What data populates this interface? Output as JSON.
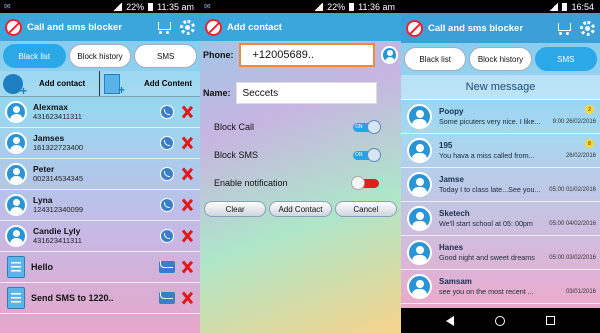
{
  "panel1": {
    "status": {
      "battery": "22%",
      "time": "11:35 am"
    },
    "app_title": "Call and sms blocker",
    "tabs": [
      "Black list",
      "Block history",
      "SMS"
    ],
    "add_contact": "Add contact",
    "add_content": "Add Content",
    "rows": [
      {
        "name": "Alexmax",
        "number": "431623411311",
        "type": "contact"
      },
      {
        "name": "Jamses",
        "number": "161322723400",
        "type": "contact"
      },
      {
        "name": "Peter",
        "number": "002314534345",
        "type": "contact"
      },
      {
        "name": "Lyna",
        "number": "124312340099",
        "type": "contact"
      },
      {
        "name": "Candie Lyly",
        "number": "431623411311",
        "type": "contact"
      },
      {
        "name": "Hello",
        "number": "",
        "type": "content"
      },
      {
        "name": "Send SMS to 1220..",
        "number": "",
        "type": "content"
      }
    ]
  },
  "panel2": {
    "status": {
      "battery": "22%",
      "time": "11:36 am"
    },
    "app_title": "Add contact",
    "phone_label": "Phone:",
    "phone_value": "+12005689..",
    "name_label": "Name:",
    "name_value": "Seccets",
    "options": [
      {
        "label": "Block Call",
        "state": "ON"
      },
      {
        "label": "Block SMS",
        "state": "ON"
      },
      {
        "label": "Enable notification",
        "state": "OFF"
      }
    ],
    "buttons": [
      "Clear",
      "Add Contact",
      "Cancel"
    ]
  },
  "panel3": {
    "status": {
      "time": "16:54"
    },
    "app_title": "Call and sms blocker",
    "tabs": [
      "Black list",
      "Block history",
      "SMS"
    ],
    "new_message": "New message",
    "messages": [
      {
        "sender": "Poopy",
        "preview": "Some picuters very nice. I like...",
        "time": "9:00 26/02/2016",
        "badge": "2"
      },
      {
        "sender": "195",
        "preview": "You hava a miss called from...",
        "time": "26/02/2016",
        "badge": "8"
      },
      {
        "sender": "Jamse",
        "preview": "Today I to class late...See you...",
        "time": "05:00 01/02/2016",
        "badge": ""
      },
      {
        "sender": "Sketech",
        "preview": "We'll start school at 05: 00pm",
        "time": "05:00 04/02/2016",
        "badge": ""
      },
      {
        "sender": "Hanes",
        "preview": "Good night and sweet dreams",
        "time": "05:00 03/02/2016",
        "badge": ""
      },
      {
        "sender": "Samsam",
        "preview": "see you on the most recent ...",
        "time": "03/01/2016",
        "badge": ""
      }
    ]
  }
}
